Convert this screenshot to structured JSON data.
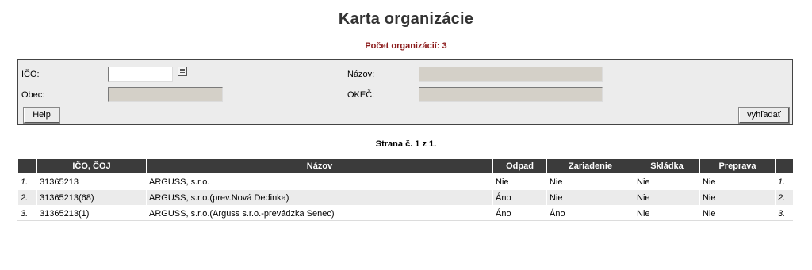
{
  "page": {
    "title": "Karta organizácie",
    "count_label": "Počet organizácií: 3",
    "page_info": "Strana č. 1 z 1."
  },
  "filter": {
    "ico_label": "IČO:",
    "ico_value": "",
    "nazov_label": "Názov:",
    "nazov_value": "",
    "obec_label": "Obec:",
    "obec_value": "",
    "okec_label": "OKEČ:",
    "okec_value": "",
    "help_label": "Help",
    "search_label": "vyhľadať"
  },
  "table": {
    "columns": [
      "",
      "IČO, ČOJ",
      "Názov",
      "Odpad",
      "Zariadenie",
      "Skládka",
      "Preprava",
      ""
    ],
    "rows": [
      {
        "index": "1.",
        "ico": "31365213",
        "nazov": "ARGUSS, s.r.o.",
        "odpad": "Nie",
        "zariadenie": "Nie",
        "skladka": "Nie",
        "preprava": "Nie",
        "index_end": "1."
      },
      {
        "index": "2.",
        "ico": "31365213(68)",
        "nazov": "ARGUSS, s.r.o.(prev.Nová Dedinka)",
        "odpad": "Áno",
        "zariadenie": "Nie",
        "skladka": "Nie",
        "preprava": "Nie",
        "index_end": "2."
      },
      {
        "index": "3.",
        "ico": "31365213(1)",
        "nazov": "ARGUSS, s.r.o.(Arguss s.r.o.-prevádzka Senec)",
        "odpad": "Áno",
        "zariadenie": "Áno",
        "skladka": "Nie",
        "preprava": "Nie",
        "index_end": "3."
      }
    ]
  },
  "colors": {
    "header_bg": "#3b3b3b",
    "count_text": "#8b1a1a",
    "filter_bg": "#ececec",
    "disabled_input_bg": "#d4d0c8",
    "even_row_bg": "#ebebeb"
  }
}
